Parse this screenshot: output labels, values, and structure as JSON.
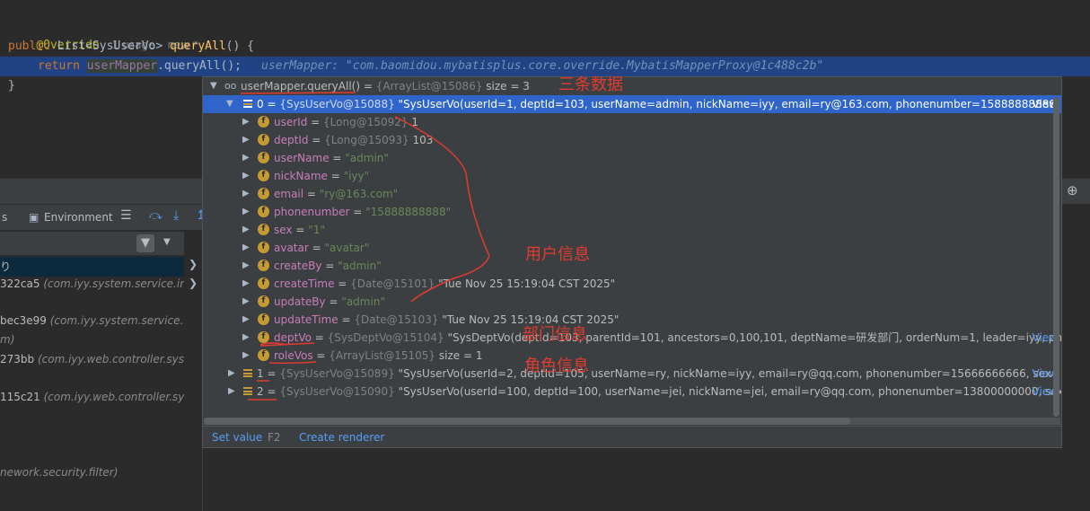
{
  "editor": {
    "annotation": "@Override",
    "usage_hint": "1 usage",
    "new_hint": "new *",
    "sig_public": "public",
    "sig_type": "List<SysUserVo>",
    "sig_method": "queryAll",
    "sig_tail": "() {",
    "ret_kw": "return",
    "ret_obj": "userMapper",
    "ret_call": ".queryAll();",
    "inline_value": "userMapper: \"com.baomidou.mybatisplus.core.override.MybatisMapperProxy@1c488c2b\"",
    "closing": "}"
  },
  "debug": {
    "tab_threads": "s",
    "tab_environment": "Environment",
    "frames_col_label": "Ev",
    "frames": [
      {
        "main": "り",
        "sub": ""
      },
      {
        "main": "322ca5",
        "sub": "(com.iyy.system.service.imp"
      },
      {
        "main": "bec3e99",
        "sub": "(com.iyy.system.service.in"
      },
      {
        "main": "m)",
        "sub": ""
      },
      {
        "main": "273bb",
        "sub": "(com.iyy.web.controller.syste"
      },
      {
        "main": "115c21",
        "sub": "(com.iyy.web.controller.syst"
      },
      {
        "main": "nework.security.filter)",
        "sub": ""
      }
    ]
  },
  "popup": {
    "root": {
      "name": "userMapper.queryAll()",
      "ref": "{ArrayList@15086}",
      "extra": "size = 3"
    },
    "item0": {
      "index": "0",
      "ref": "{SysUserVo@15088}",
      "value": "\"SysUserVo(userId=1, deptId=103, userName=admin, nickName=iyy, email=ry@163.com, phonenumber=15888888888, s...",
      "view": "View"
    },
    "fields": [
      {
        "name": "userId",
        "ref": "{Long@15092}",
        "value": "1",
        "kind": "num"
      },
      {
        "name": "deptId",
        "ref": "{Long@15093}",
        "value": "103",
        "kind": "num"
      },
      {
        "name": "userName",
        "ref": "",
        "value": "\"admin\"",
        "kind": "str"
      },
      {
        "name": "nickName",
        "ref": "",
        "value": "\"iyy\"",
        "kind": "str"
      },
      {
        "name": "email",
        "ref": "",
        "value": "\"ry@163.com\"",
        "kind": "str"
      },
      {
        "name": "phonenumber",
        "ref": "",
        "value": "\"15888888888\"",
        "kind": "str"
      },
      {
        "name": "sex",
        "ref": "",
        "value": "\"1\"",
        "kind": "str"
      },
      {
        "name": "avatar",
        "ref": "",
        "value": "\"avatar\"",
        "kind": "str"
      },
      {
        "name": "createBy",
        "ref": "",
        "value": "\"admin\"",
        "kind": "str"
      },
      {
        "name": "createTime",
        "ref": "{Date@15101}",
        "value": "\"Tue Nov 25 15:19:04 CST 2025\"",
        "kind": "num"
      },
      {
        "name": "updateBy",
        "ref": "",
        "value": "\"admin\"",
        "kind": "str"
      },
      {
        "name": "updateTime",
        "ref": "{Date@15103}",
        "value": "\"Tue Nov 25 15:19:04 CST 2025\"",
        "kind": "num"
      },
      {
        "name": "deptVo",
        "ref": "{SysDeptVo@15104}",
        "value": "\"SysDeptVo(deptId=103, parentId=101, ancestors=0,100,101, deptName=研发部门, orderNum=1, leader=iyy, ph...",
        "kind": "num",
        "view": "View"
      },
      {
        "name": "roleVos",
        "ref": "{ArrayList@15105}",
        "value": "size = 1",
        "kind": "num"
      }
    ],
    "item1": {
      "index": "1",
      "ref": "{SysUserVo@15089}",
      "value": "\"SysUserVo(userId=2, deptId=105, userName=ry, nickName=iyy, email=ry@qq.com, phonenumber=15666666666, sex=1...",
      "view": "View"
    },
    "item2": {
      "index": "2",
      "ref": "{SysUserVo@15090}",
      "value": "\"SysUserVo(userId=100, deptId=100, userName=jei, nickName=jei, email=ry@qq.com, phonenumber=13800000000, sex...",
      "view": "View"
    },
    "footer": {
      "set_value": "Set value",
      "shortcut": "F2",
      "create_renderer": "Create renderer"
    }
  },
  "annotations": {
    "three_records": "三条数据",
    "user_info": "用户信息",
    "dept_info": "部门信息",
    "role_info": "角色信息",
    "color": "#e03c31"
  }
}
